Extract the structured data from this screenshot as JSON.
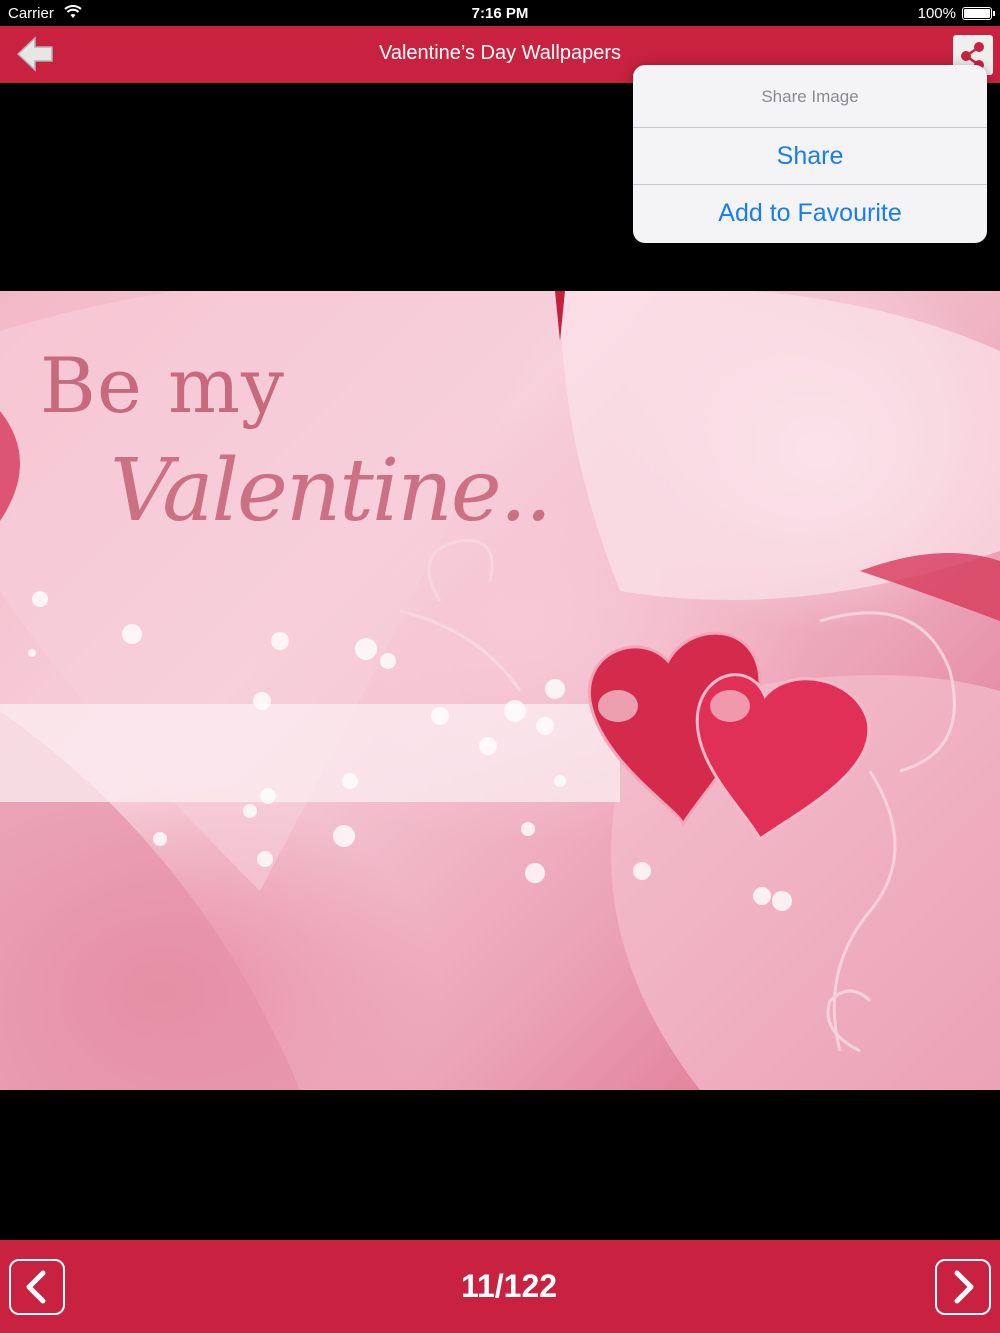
{
  "status_bar": {
    "carrier": "Carrier",
    "time": "7:16 PM",
    "battery": "100%"
  },
  "nav": {
    "title": "Valentine’s Day Wallpapers",
    "back_icon": "back-arrow-icon",
    "share_icon": "share-icon"
  },
  "wallpaper": {
    "line1": "Be my",
    "line2": "Valentine.."
  },
  "popover": {
    "header": "Share Image",
    "options": [
      "Share",
      "Add to Favourite"
    ]
  },
  "bottom": {
    "counter": "11/122",
    "prev_icon": "chevron-left-icon",
    "next_icon": "chevron-right-icon"
  },
  "colors": {
    "bar": "#c82240",
    "link": "#1a7cf5"
  }
}
